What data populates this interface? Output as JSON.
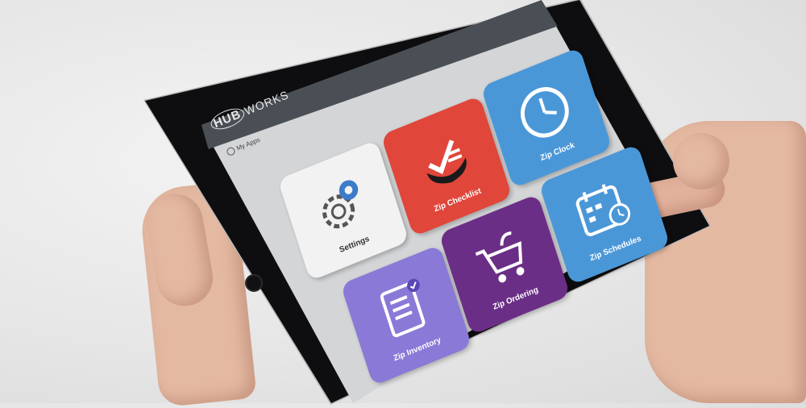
{
  "header": {
    "brand_logo": "HUB",
    "brand_text": "WORKS",
    "section": "My Apps"
  },
  "apps": [
    {
      "label": "Settings",
      "icon": "gear-icon",
      "color": "#f2f2f2"
    },
    {
      "label": "Zip Checklist",
      "icon": "checklist-icon",
      "color": "#e0463a"
    },
    {
      "label": "Zip Clock",
      "icon": "clock-icon",
      "color": "#4a97d8"
    },
    {
      "label": "Zip Inventory",
      "icon": "inventory-icon",
      "color": "#8a79d6"
    },
    {
      "label": "Zip Ordering",
      "icon": "cart-icon",
      "color": "#6b2e86"
    },
    {
      "label": "Zip Schedules",
      "icon": "calendar-icon",
      "color": "#4a97d8"
    }
  ]
}
